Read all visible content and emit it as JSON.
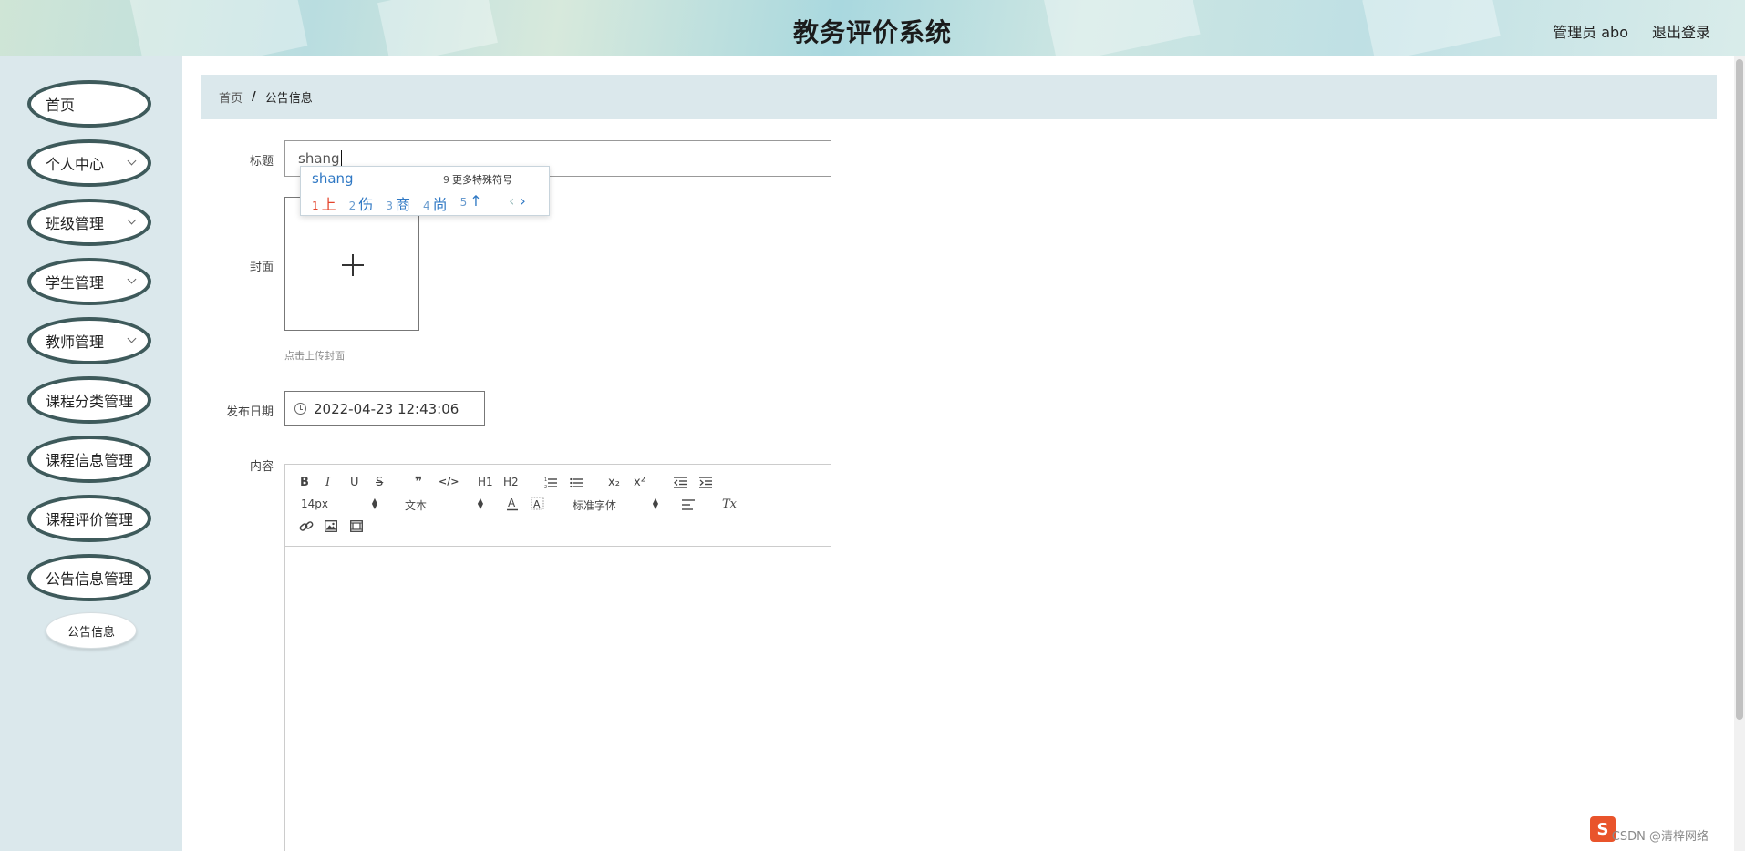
{
  "header": {
    "title": "教务评价系统",
    "user_label": "管理员 abo",
    "logout_label": "退出登录"
  },
  "sidebar": {
    "items": [
      {
        "label": "首页",
        "has_submenu": false
      },
      {
        "label": "个人中心",
        "has_submenu": true
      },
      {
        "label": "班级管理",
        "has_submenu": true
      },
      {
        "label": "学生管理",
        "has_submenu": true
      },
      {
        "label": "教师管理",
        "has_submenu": true
      },
      {
        "label": "课程分类管理",
        "has_submenu": false
      },
      {
        "label": "课程信息管理",
        "has_submenu": false
      },
      {
        "label": "课程评价管理",
        "has_submenu": false
      },
      {
        "label": "公告信息管理",
        "has_submenu": false
      }
    ],
    "active_submenu": "公告信息"
  },
  "breadcrumb": {
    "home": "首页",
    "separator": "/",
    "current": "公告信息"
  },
  "form": {
    "title_label": "标题",
    "title_value": "shang",
    "cover_label": "封面",
    "cover_hint": "点击上传封面",
    "date_label": "发布日期",
    "date_value": "2022-04-23 12:43:06",
    "content_label": "内容"
  },
  "ime": {
    "composition": "shang",
    "more_num": "9",
    "more_label": "更多特殊符号",
    "candidates": [
      {
        "n": "1",
        "text": "上"
      },
      {
        "n": "2",
        "text": "伤"
      },
      {
        "n": "3",
        "text": "商"
      },
      {
        "n": "4",
        "text": "尚"
      },
      {
        "n": "5",
        "text": "↑"
      }
    ],
    "prev": "‹",
    "next": "›"
  },
  "editor": {
    "bold": "B",
    "italic": "I",
    "underline": "U",
    "strike": "S",
    "quote": "❞",
    "code": "</>",
    "h1": "H1",
    "h2": "H2",
    "sub": "x₂",
    "sup": "x²",
    "size_select": "14px",
    "header_select": "文本",
    "font_select": "标准字体",
    "clean": "Tx"
  },
  "watermark": "CSDN @清梓网络"
}
